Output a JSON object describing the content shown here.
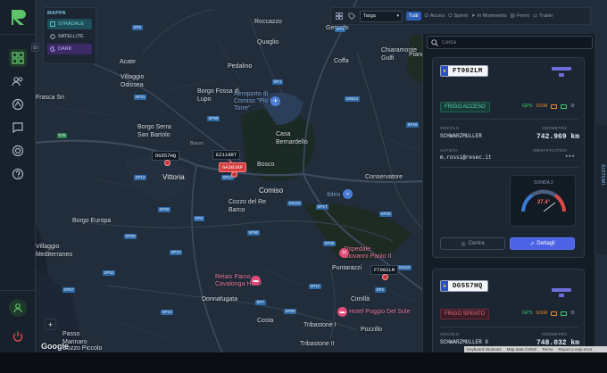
{
  "map_type_panel": {
    "title": "MAPPA",
    "options": [
      {
        "label": "STRADALE",
        "selected": true
      },
      {
        "label": "SATELLITE",
        "selected": false
      },
      {
        "label": "DARK",
        "selected": true
      }
    ]
  },
  "topbar": {
    "select_value": "Targa",
    "filters": [
      {
        "label": "Tutti",
        "active": true
      },
      {
        "label": "Accesi",
        "active": false
      },
      {
        "label": "Spenti",
        "active": false
      },
      {
        "label": "In Movimento",
        "active": false
      },
      {
        "label": "Fermi",
        "active": false
      },
      {
        "label": "Trailer",
        "active": false
      }
    ]
  },
  "search": {
    "placeholder": "Cerca"
  },
  "vehicles": [
    {
      "plate": "FT902LM",
      "status": "FRIGO ACCESO",
      "gps": "GPS",
      "gsm": "GSM",
      "vehicle_label": "VEICOLO",
      "vehicle_value": "SCHWARZMULLER",
      "odometer_label": "ODOMETRO",
      "odometer_value": "742.969 km",
      "driver_label": "AUTISTA",
      "driver_value": "m.rossi@resec.it",
      "id_label": "IDENTIFICATIVO",
      "id_value": "***",
      "sensor_title": "SONDA 2",
      "sensor_value": "27.4°",
      "center_button": "Centra",
      "details_button": "Dettagli"
    },
    {
      "plate": "DG557HQ",
      "status": "FRIGO SPENTO",
      "gps": "GPS",
      "gsm": "GSM",
      "vehicle_label": "VEICOLO",
      "vehicle_value": "SCHWARZMULLER X",
      "odometer_label": "ODOMETRO",
      "odometer_value": "748.032 km"
    }
  ],
  "side_tab": "SISTEMI",
  "map_labels": {
    "places": [
      "Roccazzo",
      "Gerardo",
      "Quaglio",
      "Coffa",
      "Chiaramonte Gulfi",
      "Acate",
      "Pedalino",
      "Villaggio Odissea",
      "Borgo Fossa di Lupo",
      "Aeroporto di Comiso \"Pio La Torre\"",
      "Piano Rossi",
      "Borgo Serra San Bartolo",
      "Casa Bernardello",
      "Vittoria",
      "Bosco",
      "Comiso",
      "Ibleo",
      "Conservatore",
      "Cozzo del Re Barco",
      "Borgo Europa",
      "Puntarazzi",
      "Ospedale Giovanni Paolo II",
      "Relais Parco Cavalonga Hotel",
      "Donnafugata",
      "Costa",
      "Cimillà",
      "Hotel Poggio Del Sole",
      "Tribastone I",
      "Tribastone II",
      "Pozzillo",
      "Passo Marinaro",
      "Cozzo Piccolo",
      "Villaggio Mediterraneo",
      "Biazzo",
      "Frasca Sri"
    ],
    "roads": [
      "SP3",
      "SP5",
      "SP4",
      "SS514",
      "SS115",
      "SP31",
      "SP68",
      "SP12",
      "SP17",
      "SP20",
      "SP8",
      "SP60",
      "SP17",
      "SP25",
      "SP36",
      "E45",
      "SP50",
      "SP52",
      "SP57",
      "SP10",
      "SP60",
      "SP11",
      "SS115",
      "SP2",
      "SP7",
      "SP14",
      "SP16"
    ]
  },
  "vehicle_markers": [
    "DG557HQ",
    "EZ118RT",
    "GA381KP",
    "FT902LM"
  ],
  "zoom_label": "+",
  "google_logo": "Google",
  "attribution": [
    "Keyboard shortcuts",
    "Map data ©2026",
    "Terms",
    "Report a map error"
  ]
}
